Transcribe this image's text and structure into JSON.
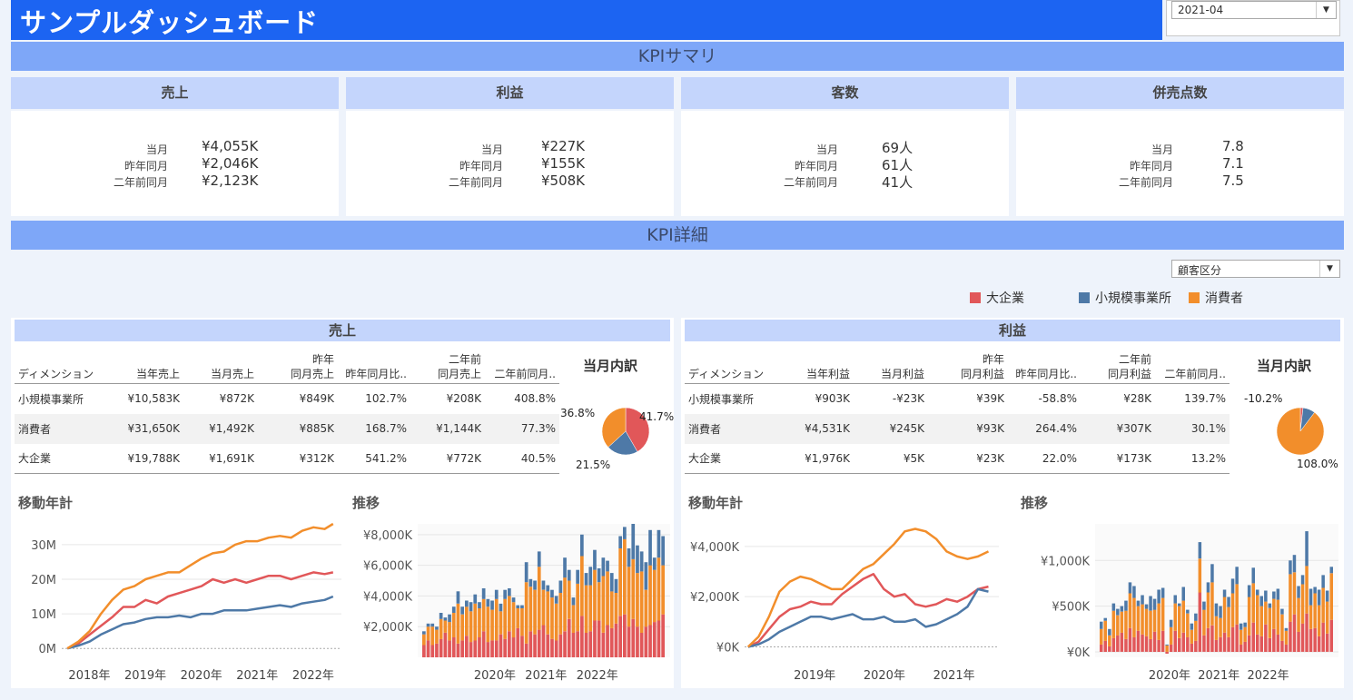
{
  "header": {
    "title": "サンプルダッシュボード",
    "month_value": "2021-04"
  },
  "colors": {
    "corp": "#e15759",
    "small": "#4e79a7",
    "consumer": "#f28e2b",
    "header": "#1c64f2",
    "band": "#7ea7f8",
    "subhead": "#c4d5fc"
  },
  "kpi_summary": {
    "title": "KPIサマリ",
    "row_labels": [
      "当月",
      "昨年同月",
      "二年前同月"
    ],
    "cards": [
      {
        "title": "売上",
        "values": [
          "¥4,055K",
          "¥2,046K",
          "¥2,123K"
        ]
      },
      {
        "title": "利益",
        "values": [
          "¥227K",
          "¥155K",
          "¥508K"
        ]
      },
      {
        "title": "客数",
        "values": [
          "69人",
          "61人",
          "41人"
        ]
      },
      {
        "title": "併売点数",
        "values": [
          "7.8",
          "7.1",
          "7.5"
        ]
      }
    ]
  },
  "kpi_detail": {
    "title": "KPI詳細",
    "dimension_value": "顧客区分",
    "legend": [
      {
        "label": "大企業",
        "color": "#e15759"
      },
      {
        "label": "小規模事業所",
        "color": "#4e79a7"
      },
      {
        "label": "消費者",
        "color": "#f28e2b"
      }
    ]
  },
  "sales_panel": {
    "title": "売上",
    "table": {
      "headers": [
        {
          "top": "",
          "bottom": "ディメンション"
        },
        {
          "top": "",
          "bottom": "当年売上"
        },
        {
          "top": "",
          "bottom": "当月売上"
        },
        {
          "top": "昨年",
          "bottom": "同月売上"
        },
        {
          "top": "",
          "bottom": "昨年同月比.."
        },
        {
          "top": "二年前",
          "bottom": "同月売上"
        },
        {
          "top": "",
          "bottom": "二年前同月.."
        }
      ],
      "rows": [
        [
          "小規模事業所",
          "¥10,583K",
          "¥872K",
          "¥849K",
          "102.7%",
          "¥208K",
          "408.8%"
        ],
        [
          "消費者",
          "¥31,650K",
          "¥1,492K",
          "¥885K",
          "168.7%",
          "¥1,144K",
          "77.3%"
        ],
        [
          "大企業",
          "¥19,788K",
          "¥1,691K",
          "¥312K",
          "541.2%",
          "¥772K",
          "40.5%"
        ]
      ]
    },
    "pie_title": "当月内訳",
    "pie_labels": {
      "corp": "41.7%",
      "small": "21.5%",
      "consumer": "36.8%"
    },
    "moving_title": "移動年計",
    "trend_title": "推移"
  },
  "profit_panel": {
    "title": "利益",
    "table": {
      "headers": [
        {
          "top": "",
          "bottom": "ディメンション"
        },
        {
          "top": "",
          "bottom": "当年利益"
        },
        {
          "top": "",
          "bottom": "当月利益"
        },
        {
          "top": "昨年",
          "bottom": "同月利益"
        },
        {
          "top": "",
          "bottom": "昨年同月比.."
        },
        {
          "top": "二年前",
          "bottom": "同月利益"
        },
        {
          "top": "",
          "bottom": "二年前同月.."
        }
      ],
      "rows": [
        [
          "小規模事業所",
          "¥903K",
          "-¥23K",
          "¥39K",
          "-58.8%",
          "¥28K",
          "139.7%"
        ],
        [
          "消費者",
          "¥4,531K",
          "¥245K",
          "¥93K",
          "264.4%",
          "¥307K",
          "30.1%"
        ],
        [
          "大企業",
          "¥1,976K",
          "¥5K",
          "¥23K",
          "22.0%",
          "¥173K",
          "13.2%"
        ]
      ]
    },
    "pie_title": "当月内訳",
    "pie_labels": {
      "small": "-10.2%",
      "consumer": "108.0%"
    },
    "moving_title": "移動年計",
    "trend_title": "推移"
  },
  "chart_data": [
    {
      "type": "pie",
      "id": "sales_pie",
      "categories": [
        "大企業",
        "小規模事業所",
        "消費者"
      ],
      "values": [
        41.7,
        21.5,
        36.8
      ]
    },
    {
      "type": "pie",
      "id": "profit_pie",
      "categories": [
        "大企業",
        "小規模事業所",
        "消費者"
      ],
      "values": [
        2.2,
        -10.2,
        108.0
      ]
    },
    {
      "type": "line",
      "id": "sales_moving",
      "ytick_labels": [
        "0M",
        "10M",
        "20M",
        "30M"
      ],
      "yticks": [
        0,
        10,
        20,
        30
      ],
      "ylim": [
        -1,
        36
      ],
      "xtick_labels": [
        "2018年",
        "2019年",
        "2020年",
        "2021年",
        "2022年"
      ],
      "xticks": [
        2018,
        2019,
        2020,
        2021,
        2022
      ],
      "xlim": [
        2017.7,
        2022.7
      ],
      "x": [
        2017.8,
        2018.0,
        2018.2,
        2018.4,
        2018.6,
        2018.8,
        2019.0,
        2019.2,
        2019.4,
        2019.6,
        2019.8,
        2020.0,
        2020.2,
        2020.4,
        2020.6,
        2020.8,
        2021.0,
        2021.2,
        2021.4,
        2021.6,
        2021.8,
        2022.0,
        2022.2,
        2022.4,
        2022.55
      ],
      "series": [
        {
          "name": "大企業",
          "values": [
            0,
            1.5,
            4,
            6.5,
            9,
            12,
            12,
            14,
            13,
            15,
            16,
            17,
            18,
            20,
            19,
            20,
            19,
            20,
            21,
            21,
            20,
            21,
            22,
            21.5,
            22
          ]
        },
        {
          "name": "小規模事業所",
          "values": [
            0,
            0.8,
            2,
            4,
            5.5,
            7,
            7.5,
            8.5,
            9,
            9,
            9.5,
            9,
            10,
            10,
            11,
            11,
            11,
            11.5,
            12,
            12.5,
            12,
            13,
            13.5,
            14,
            15
          ]
        },
        {
          "name": "消費者",
          "values": [
            0,
            2,
            5,
            10,
            14,
            17,
            18,
            20,
            21,
            22,
            22,
            24,
            26,
            27.5,
            28,
            30,
            31,
            31,
            32,
            32.5,
            32,
            34,
            35,
            34.5,
            36
          ]
        }
      ]
    },
    {
      "type": "line",
      "id": "profit_moving",
      "ytick_labels": [
        "¥0K",
        "¥2,000K",
        "¥4,000K"
      ],
      "yticks": [
        0,
        2000,
        4000
      ],
      "ylim": [
        -200,
        4900
      ],
      "xtick_labels": [
        "2019年",
        "2020年",
        "2021年"
      ],
      "xticks": [
        2019,
        2020,
        2021
      ],
      "xlim": [
        2018.15,
        2021.8
      ],
      "x": [
        2018.2,
        2018.35,
        2018.5,
        2018.65,
        2018.8,
        2018.95,
        2019.1,
        2019.25,
        2019.4,
        2019.55,
        2019.7,
        2019.85,
        2020.0,
        2020.15,
        2020.3,
        2020.45,
        2020.6,
        2020.75,
        2020.9,
        2021.05,
        2021.2,
        2021.35,
        2021.5,
        2021.65
      ],
      "series": [
        {
          "name": "大企業",
          "values": [
            0,
            200,
            700,
            1200,
            1500,
            1600,
            1800,
            1700,
            1700,
            2100,
            2400,
            2700,
            2900,
            2300,
            2000,
            2100,
            1700,
            1600,
            1700,
            1900,
            1800,
            2000,
            2300,
            2400
          ]
        },
        {
          "name": "小規模事業所",
          "values": [
            0,
            100,
            300,
            600,
            800,
            1000,
            1200,
            1200,
            1100,
            1200,
            1300,
            1100,
            1100,
            1200,
            1000,
            1000,
            1100,
            800,
            900,
            1100,
            1300,
            1600,
            2300,
            2200
          ]
        },
        {
          "name": "消費者",
          "values": [
            0,
            400,
            1200,
            2200,
            2600,
            2800,
            2700,
            2500,
            2300,
            2300,
            2700,
            3100,
            3300,
            3700,
            4100,
            4600,
            4700,
            4600,
            4300,
            3800,
            3600,
            3500,
            3600,
            3800
          ]
        }
      ]
    },
    {
      "type": "bar",
      "id": "sales_trend",
      "stacked": true,
      "ytick_labels": [
        "¥2,000K",
        "¥4,000K",
        "¥6,000K",
        "¥8,000K"
      ],
      "yticks": [
        2000,
        4000,
        6000,
        8000
      ],
      "ylim": [
        0,
        8700
      ],
      "xtick_labels": [
        "2020年",
        "2021年",
        "2022年"
      ],
      "xtick_index": [
        17,
        29,
        41
      ],
      "series": [
        {
          "name": "大企業",
          "values": [
            800,
            1100,
            800,
            900,
            1200,
            1600,
            1100,
            1300,
            900,
            1100,
            1400,
            1000,
            1100,
            1300,
            1700,
            1000,
            1100,
            1100,
            1500,
            1200,
            1700,
            1300,
            1900,
            1400,
            900,
            1700,
            1500,
            1800,
            2100,
            1500,
            1200,
            1100,
            1500,
            1700,
            2500,
            1600,
            1700,
            2700,
            1600,
            1700,
            2400,
            2400,
            1600,
            2100,
            1900,
            2200,
            2700,
            2800,
            2000,
            2500,
            2000,
            1600,
            2000,
            2100,
            2300,
            2400,
            2800
          ]
        },
        {
          "name": "消費者",
          "values": [
            700,
            900,
            1200,
            900,
            1300,
            800,
            1200,
            1600,
            2600,
            1700,
            1900,
            2000,
            2400,
            1900,
            2100,
            2300,
            2000,
            2700,
            1500,
            2600,
            2300,
            2300,
            1300,
            1800,
            4000,
            2900,
            2900,
            4100,
            2300,
            2800,
            2700,
            2400,
            2700,
            3500,
            2500,
            1800,
            3100,
            3900,
            3100,
            3000,
            3300,
            2500,
            3700,
            3500,
            2400,
            2000,
            4400,
            4900,
            3900,
            3900,
            3500,
            4000,
            2400,
            3900,
            3400,
            4100,
            3200
          ]
        },
        {
          "name": "小規模事業所",
          "values": [
            200,
            200,
            200,
            200,
            400,
            200,
            500,
            400,
            800,
            500,
            400,
            600,
            600,
            400,
            700,
            500,
            600,
            600,
            500,
            600,
            500,
            300,
            200,
            200,
            1300,
            500,
            600,
            1000,
            600,
            400,
            500,
            500,
            800,
            1300,
            700,
            500,
            900,
            1400,
            800,
            1200,
            1300,
            900,
            1200,
            700,
            1200,
            900,
            800,
            800,
            1200,
            2300,
            1800,
            1300,
            1800,
            2300,
            800,
            1800,
            1900
          ]
        }
      ]
    },
    {
      "type": "bar",
      "id": "profit_trend",
      "stacked": true,
      "ytick_labels": [
        "¥0K",
        "¥500K",
        "¥1,000K"
      ],
      "yticks": [
        0,
        500,
        1000
      ],
      "ylim": [
        -60,
        1400
      ],
      "xtick_labels": [
        "2020年",
        "2021年",
        "2022年"
      ],
      "xtick_index": [
        17,
        29,
        41
      ],
      "series": [
        {
          "name": "大企業",
          "values": [
            80,
            120,
            60,
            150,
            180,
            210,
            140,
            260,
            160,
            230,
            190,
            170,
            140,
            220,
            130,
            230,
            -20,
            80,
            230,
            150,
            210,
            160,
            90,
            120,
            650,
            180,
            260,
            290,
            130,
            160,
            210,
            160,
            270,
            300,
            80,
            110,
            180,
            320,
            190,
            170,
            300,
            150,
            250,
            190,
            120,
            80,
            330,
            410,
            220,
            310,
            420,
            250,
            260,
            170,
            320,
            200,
            350
          ]
        },
        {
          "name": "消費者",
          "values": [
            170,
            220,
            120,
            300,
            220,
            230,
            310,
            380,
            430,
            270,
            330,
            300,
            310,
            240,
            400,
            360,
            70,
            190,
            300,
            350,
            350,
            260,
            150,
            220,
            370,
            280,
            390,
            470,
            260,
            210,
            390,
            330,
            370,
            440,
            160,
            160,
            420,
            430,
            430,
            330,
            250,
            330,
            330,
            380,
            290,
            150,
            520,
            460,
            370,
            430,
            520,
            260,
            380,
            340,
            380,
            350,
            510
          ]
        },
        {
          "name": "小規模事業所",
          "values": [
            80,
            30,
            70,
            80,
            70,
            60,
            110,
            120,
            130,
            60,
            100,
            50,
            160,
            120,
            150,
            110,
            10,
            80,
            90,
            30,
            150,
            40,
            70,
            80,
            180,
            90,
            110,
            200,
            140,
            130,
            80,
            110,
            160,
            190,
            70,
            50,
            130,
            170,
            60,
            110,
            120,
            50,
            80,
            120,
            60,
            30,
            150,
            190,
            130,
            100,
            380,
            180,
            70,
            170,
            140,
            120,
            70
          ]
        }
      ]
    }
  ]
}
